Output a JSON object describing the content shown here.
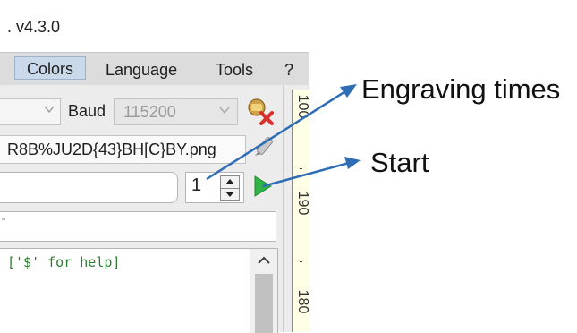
{
  "window": {
    "title": ". v4.3.0"
  },
  "menu": {
    "items": [
      "Colors",
      "Language",
      "Tools",
      "?"
    ]
  },
  "connection": {
    "baud_label": "Baud",
    "baud_value": "115200"
  },
  "file": {
    "name": "R8B%JU2D{43}BH[C}BY.png"
  },
  "engrave": {
    "times_value": "1"
  },
  "console": {
    "text": "['$' for help]"
  },
  "ruler": {
    "labels": [
      "100",
      "190",
      "180"
    ]
  },
  "annotations": {
    "engraving_times": "Engraving times",
    "start": "Start"
  },
  "colors": {
    "accent_arrow": "#2f6db5",
    "start_green": "#2fb344",
    "menu_highlight": "#c9d9ea",
    "ruler_bg": "#ffffe6"
  },
  "icons": [
    "chevron-down-icon",
    "disconnect-icon",
    "edit-icon",
    "start-play-icon",
    "scroll-up-icon"
  ]
}
